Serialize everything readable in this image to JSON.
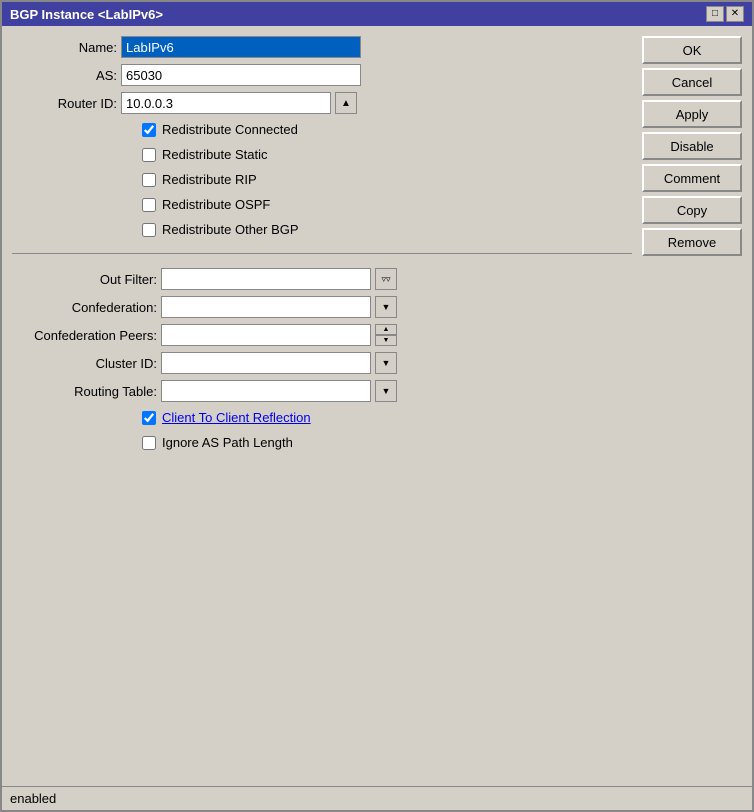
{
  "titleBar": {
    "title": "BGP Instance <LabIPv6>",
    "minimizeIcon": "▭",
    "closeIcon": "✕"
  },
  "form": {
    "nameLabel": "Name:",
    "nameValue": "LabIPv6",
    "asLabel": "AS:",
    "asValue": "65030",
    "routerIdLabel": "Router ID:",
    "routerIdValue": "10.0.0.3",
    "checkboxes": [
      {
        "id": "cb-redistribute-connected",
        "label": "Redistribute Connected",
        "checked": true
      },
      {
        "id": "cb-redistribute-static",
        "label": "Redistribute Static",
        "checked": false
      },
      {
        "id": "cb-redistribute-rip",
        "label": "Redistribute RIP",
        "checked": false
      },
      {
        "id": "cb-redistribute-ospf",
        "label": "Redistribute OSPF",
        "checked": false
      },
      {
        "id": "cb-redistribute-other-bgp",
        "label": "Redistribute Other BGP",
        "checked": false
      }
    ],
    "dropdowns": [
      {
        "id": "out-filter",
        "label": "Out Filter:",
        "value": "",
        "type": "dropdown-filter"
      },
      {
        "id": "confederation",
        "label": "Confederation:",
        "value": "",
        "type": "dropdown"
      },
      {
        "id": "confederation-peers",
        "label": "Confederation Peers:",
        "value": "",
        "type": "spinner"
      },
      {
        "id": "cluster-id",
        "label": "Cluster ID:",
        "value": "",
        "type": "dropdown"
      },
      {
        "id": "routing-table",
        "label": "Routing Table:",
        "value": "",
        "type": "dropdown"
      }
    ],
    "bottomCheckboxes": [
      {
        "id": "cb-client-reflection",
        "label": "Client To Client Reflection",
        "checked": true,
        "linkStyle": true
      },
      {
        "id": "cb-ignore-as",
        "label": "Ignore AS Path Length",
        "checked": false,
        "linkStyle": false
      }
    ]
  },
  "buttons": {
    "ok": "OK",
    "cancel": "Cancel",
    "apply": "Apply",
    "disable": "Disable",
    "comment": "Comment",
    "copy": "Copy",
    "remove": "Remove"
  },
  "statusBar": {
    "text": "enabled"
  }
}
